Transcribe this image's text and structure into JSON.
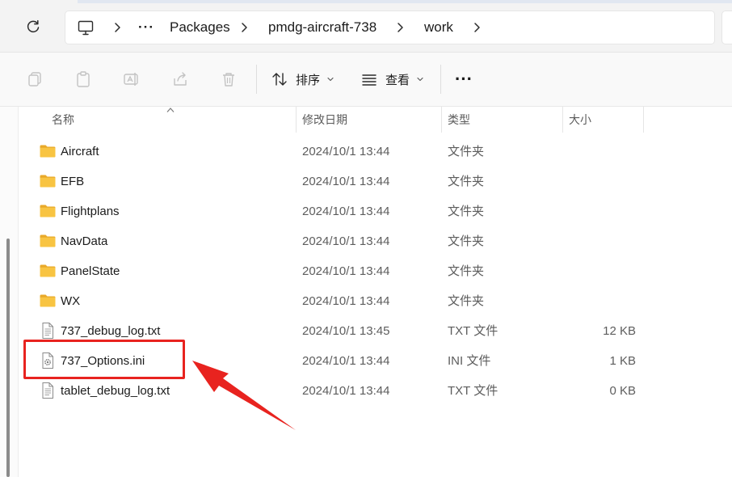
{
  "address_bar": {
    "overflow_label": "···",
    "breadcrumbs": [
      "Packages",
      "pmdg-aircraft-738",
      "work"
    ]
  },
  "toolbar": {
    "sort_label": "排序",
    "view_label": "查看",
    "more_label": "···"
  },
  "columns": {
    "name": "名称",
    "date": "修改日期",
    "type": "类型",
    "size": "大小"
  },
  "files": [
    {
      "name": "Aircraft",
      "date": "2024/10/1 13:44",
      "type": "文件夹",
      "size": "",
      "kind": "folder"
    },
    {
      "name": "EFB",
      "date": "2024/10/1 13:44",
      "type": "文件夹",
      "size": "",
      "kind": "folder"
    },
    {
      "name": "Flightplans",
      "date": "2024/10/1 13:44",
      "type": "文件夹",
      "size": "",
      "kind": "folder"
    },
    {
      "name": "NavData",
      "date": "2024/10/1 13:44",
      "type": "文件夹",
      "size": "",
      "kind": "folder"
    },
    {
      "name": "PanelState",
      "date": "2024/10/1 13:44",
      "type": "文件夹",
      "size": "",
      "kind": "folder"
    },
    {
      "name": "WX",
      "date": "2024/10/1 13:44",
      "type": "文件夹",
      "size": "",
      "kind": "folder"
    },
    {
      "name": "737_debug_log.txt",
      "date": "2024/10/1 13:45",
      "type": "TXT 文件",
      "size": "12 KB",
      "kind": "text"
    },
    {
      "name": "737_Options.ini",
      "date": "2024/10/1 13:44",
      "type": "INI 文件",
      "size": "1 KB",
      "kind": "ini"
    },
    {
      "name": "tablet_debug_log.txt",
      "date": "2024/10/1 13:44",
      "type": "TXT 文件",
      "size": "0 KB",
      "kind": "text"
    }
  ],
  "annotation": {
    "highlighted_file": "737_Options.ini",
    "color": "#e8231f"
  },
  "colors": {
    "folder": "#f8c442",
    "folder_dark": "#e9a92a",
    "annotation": "#e8231f"
  }
}
